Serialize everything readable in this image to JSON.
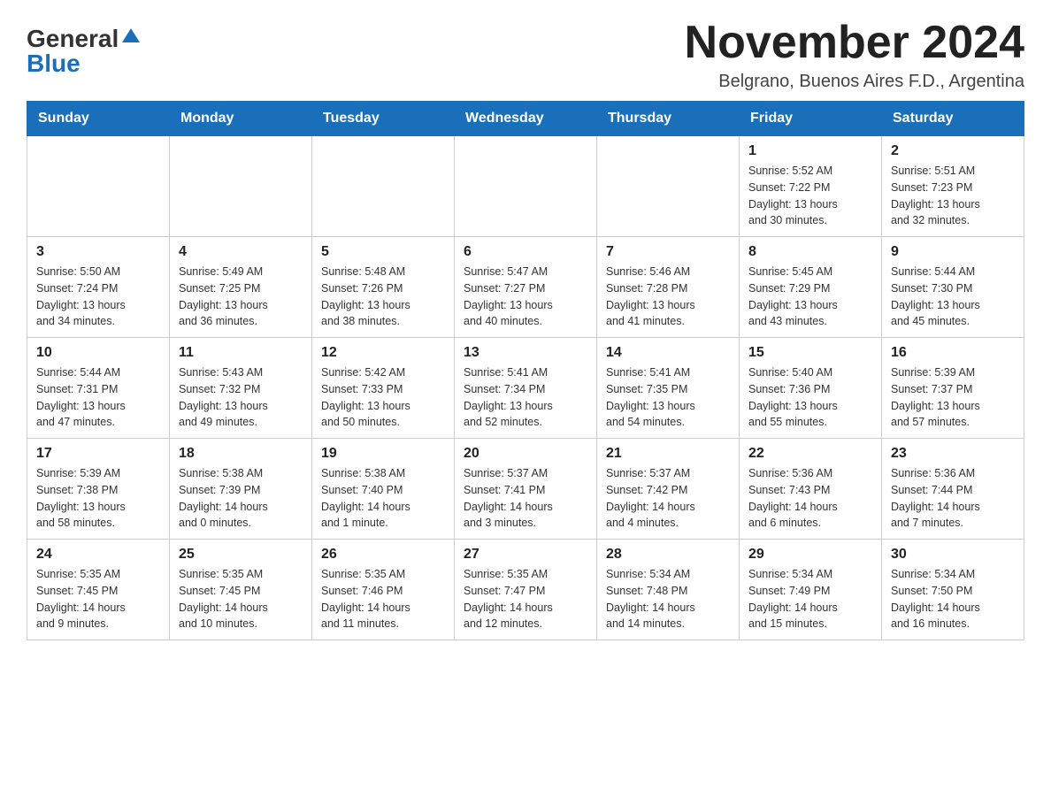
{
  "header": {
    "logo_general": "General",
    "logo_blue": "Blue",
    "month_title": "November 2024",
    "location": "Belgrano, Buenos Aires F.D., Argentina"
  },
  "days_of_week": [
    "Sunday",
    "Monday",
    "Tuesday",
    "Wednesday",
    "Thursday",
    "Friday",
    "Saturday"
  ],
  "weeks": [
    [
      {
        "day": "",
        "info": ""
      },
      {
        "day": "",
        "info": ""
      },
      {
        "day": "",
        "info": ""
      },
      {
        "day": "",
        "info": ""
      },
      {
        "day": "",
        "info": ""
      },
      {
        "day": "1",
        "info": "Sunrise: 5:52 AM\nSunset: 7:22 PM\nDaylight: 13 hours\nand 30 minutes."
      },
      {
        "day": "2",
        "info": "Sunrise: 5:51 AM\nSunset: 7:23 PM\nDaylight: 13 hours\nand 32 minutes."
      }
    ],
    [
      {
        "day": "3",
        "info": "Sunrise: 5:50 AM\nSunset: 7:24 PM\nDaylight: 13 hours\nand 34 minutes."
      },
      {
        "day": "4",
        "info": "Sunrise: 5:49 AM\nSunset: 7:25 PM\nDaylight: 13 hours\nand 36 minutes."
      },
      {
        "day": "5",
        "info": "Sunrise: 5:48 AM\nSunset: 7:26 PM\nDaylight: 13 hours\nand 38 minutes."
      },
      {
        "day": "6",
        "info": "Sunrise: 5:47 AM\nSunset: 7:27 PM\nDaylight: 13 hours\nand 40 minutes."
      },
      {
        "day": "7",
        "info": "Sunrise: 5:46 AM\nSunset: 7:28 PM\nDaylight: 13 hours\nand 41 minutes."
      },
      {
        "day": "8",
        "info": "Sunrise: 5:45 AM\nSunset: 7:29 PM\nDaylight: 13 hours\nand 43 minutes."
      },
      {
        "day": "9",
        "info": "Sunrise: 5:44 AM\nSunset: 7:30 PM\nDaylight: 13 hours\nand 45 minutes."
      }
    ],
    [
      {
        "day": "10",
        "info": "Sunrise: 5:44 AM\nSunset: 7:31 PM\nDaylight: 13 hours\nand 47 minutes."
      },
      {
        "day": "11",
        "info": "Sunrise: 5:43 AM\nSunset: 7:32 PM\nDaylight: 13 hours\nand 49 minutes."
      },
      {
        "day": "12",
        "info": "Sunrise: 5:42 AM\nSunset: 7:33 PM\nDaylight: 13 hours\nand 50 minutes."
      },
      {
        "day": "13",
        "info": "Sunrise: 5:41 AM\nSunset: 7:34 PM\nDaylight: 13 hours\nand 52 minutes."
      },
      {
        "day": "14",
        "info": "Sunrise: 5:41 AM\nSunset: 7:35 PM\nDaylight: 13 hours\nand 54 minutes."
      },
      {
        "day": "15",
        "info": "Sunrise: 5:40 AM\nSunset: 7:36 PM\nDaylight: 13 hours\nand 55 minutes."
      },
      {
        "day": "16",
        "info": "Sunrise: 5:39 AM\nSunset: 7:37 PM\nDaylight: 13 hours\nand 57 minutes."
      }
    ],
    [
      {
        "day": "17",
        "info": "Sunrise: 5:39 AM\nSunset: 7:38 PM\nDaylight: 13 hours\nand 58 minutes."
      },
      {
        "day": "18",
        "info": "Sunrise: 5:38 AM\nSunset: 7:39 PM\nDaylight: 14 hours\nand 0 minutes."
      },
      {
        "day": "19",
        "info": "Sunrise: 5:38 AM\nSunset: 7:40 PM\nDaylight: 14 hours\nand 1 minute."
      },
      {
        "day": "20",
        "info": "Sunrise: 5:37 AM\nSunset: 7:41 PM\nDaylight: 14 hours\nand 3 minutes."
      },
      {
        "day": "21",
        "info": "Sunrise: 5:37 AM\nSunset: 7:42 PM\nDaylight: 14 hours\nand 4 minutes."
      },
      {
        "day": "22",
        "info": "Sunrise: 5:36 AM\nSunset: 7:43 PM\nDaylight: 14 hours\nand 6 minutes."
      },
      {
        "day": "23",
        "info": "Sunrise: 5:36 AM\nSunset: 7:44 PM\nDaylight: 14 hours\nand 7 minutes."
      }
    ],
    [
      {
        "day": "24",
        "info": "Sunrise: 5:35 AM\nSunset: 7:45 PM\nDaylight: 14 hours\nand 9 minutes."
      },
      {
        "day": "25",
        "info": "Sunrise: 5:35 AM\nSunset: 7:45 PM\nDaylight: 14 hours\nand 10 minutes."
      },
      {
        "day": "26",
        "info": "Sunrise: 5:35 AM\nSunset: 7:46 PM\nDaylight: 14 hours\nand 11 minutes."
      },
      {
        "day": "27",
        "info": "Sunrise: 5:35 AM\nSunset: 7:47 PM\nDaylight: 14 hours\nand 12 minutes."
      },
      {
        "day": "28",
        "info": "Sunrise: 5:34 AM\nSunset: 7:48 PM\nDaylight: 14 hours\nand 14 minutes."
      },
      {
        "day": "29",
        "info": "Sunrise: 5:34 AM\nSunset: 7:49 PM\nDaylight: 14 hours\nand 15 minutes."
      },
      {
        "day": "30",
        "info": "Sunrise: 5:34 AM\nSunset: 7:50 PM\nDaylight: 14 hours\nand 16 minutes."
      }
    ]
  ]
}
